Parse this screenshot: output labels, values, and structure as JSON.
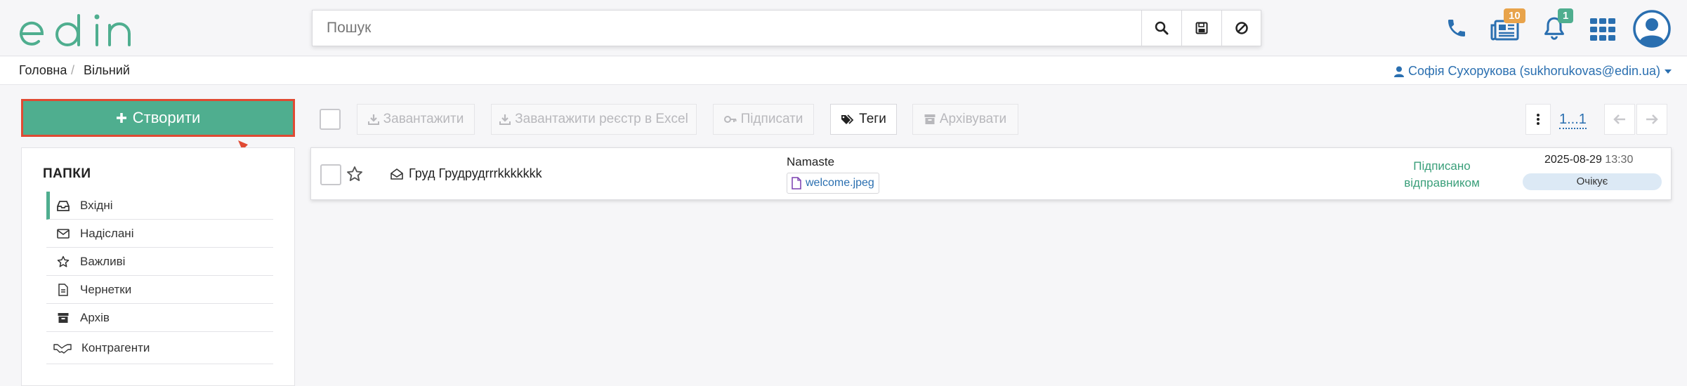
{
  "app": {
    "logo_text": "edin"
  },
  "search": {
    "placeholder": "Пошук"
  },
  "header": {
    "news_badge": "10",
    "notifications_badge": "1"
  },
  "breadcrumb": {
    "home": "Головна",
    "separator": "/",
    "current": "Вільний"
  },
  "user": {
    "label": "Софія Сухорукова (sukhorukovas@edin.ua)"
  },
  "sidebar": {
    "create_label": "Створити",
    "folders_title": "ПАПКИ",
    "items": [
      {
        "label": "Вхідні",
        "icon": "inbox-icon"
      },
      {
        "label": "Надіслані",
        "icon": "envelope-icon"
      },
      {
        "label": "Важливі",
        "icon": "star-icon"
      },
      {
        "label": "Чернетки",
        "icon": "draft-icon"
      },
      {
        "label": "Архів",
        "icon": "archive-icon"
      },
      {
        "label": "Контрагенти",
        "icon": "handshake-icon"
      }
    ]
  },
  "toolbar": {
    "download": "Завантажити",
    "download_excel": "Завантажити реєстр в Excel",
    "sign": "Підписати",
    "tags": "Теги",
    "archive": "Архівувати",
    "pagination": "1...1"
  },
  "documents": [
    {
      "sender": "Груд Грудрудrrrkkkkkkk",
      "title": "Namaste",
      "attachment": "welcome.jpeg",
      "status": "Підписано відправником",
      "status_line1": "Підписано",
      "status_line2": "відправником",
      "date": "2025-08-29",
      "time": "13:30",
      "state": "Очікує"
    }
  ],
  "colors": {
    "accent": "#4fae8f",
    "link": "#2a6fb0",
    "highlight": "#e04a33",
    "news_badge": "#e8a34b",
    "notif_badge": "#4fae8f"
  }
}
